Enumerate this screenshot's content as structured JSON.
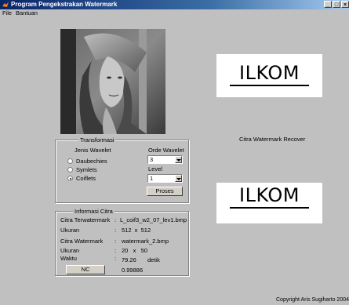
{
  "window": {
    "title": "Program Pengekstrakan Watermark",
    "minimize": "_",
    "maximize": "□",
    "close": "×"
  },
  "menu": [
    "File",
    "Bantuan"
  ],
  "watermark": {
    "top_text": "ILKOM",
    "caption": "Citra Watermark Recover",
    "bottom_text": "ILKOM"
  },
  "transformasi": {
    "legend": "Transformasi",
    "jenis_label": "Jenis Wavelet",
    "options": [
      "Daubechies",
      "Symlets",
      "Coiflets"
    ],
    "selected": "Coiflets",
    "orde_label": "Orde Wavelet",
    "orde_value": "3",
    "level_label": "Level",
    "level_value": "1",
    "proses_button": "Proses"
  },
  "info": {
    "legend": "Informasi Citra",
    "rows": [
      {
        "label": "Citra Terwatermark",
        "sep": ":",
        "value": "L_coif3_w2_07_lev1.bmp"
      },
      {
        "label": "Ukuran",
        "sep": ":",
        "value": "512  x  512"
      },
      {
        "label": "Citra Watermark",
        "sep": ":",
        "value": "watermark_2.bmp"
      },
      {
        "label": "Ukuran",
        "sep": ":",
        "value": "20   x   50"
      },
      {
        "label": "Waktu",
        "sep": ":",
        "value": "79.26",
        "unit": "detik"
      }
    ],
    "nc_button": "NC",
    "nc_value": "0.99886"
  },
  "footer": {
    "copyright": "Copyright Aris Sugiharto 2004"
  }
}
